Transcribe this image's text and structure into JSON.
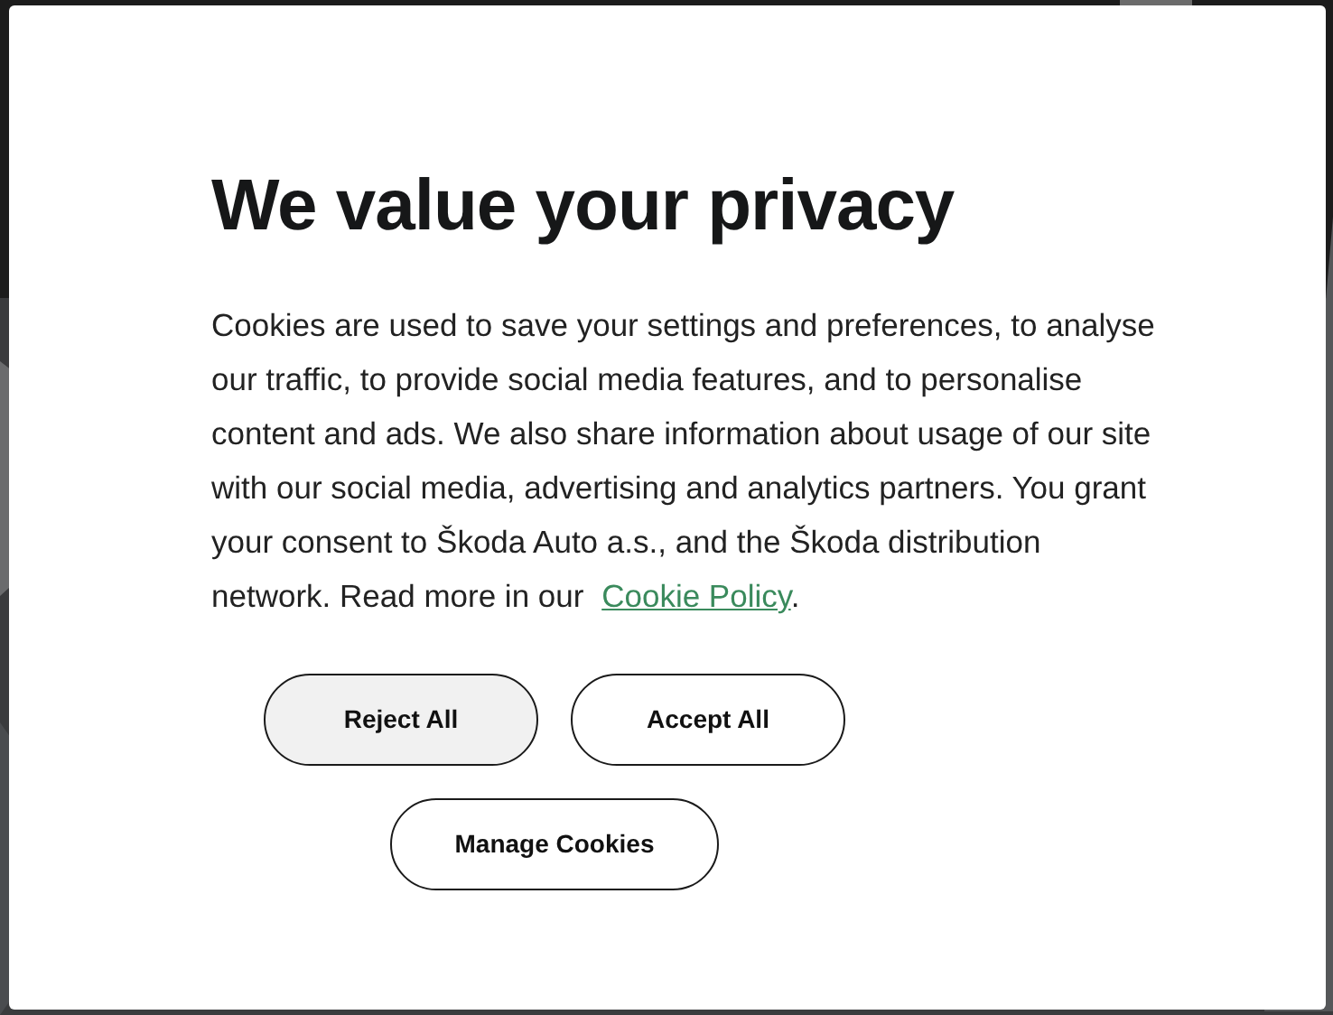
{
  "dialog": {
    "title": "We value your privacy",
    "body": "Cookies are used to save your settings and preferences, to analyse our traffic, to provide social media features, and to personalise content and ads. We also share information about usage of our site with our social media, advertising and analytics partners. You grant your consent to Škoda Auto a.s., and the Škoda distribution network. Read more in our",
    "link": "Cookie Policy",
    "after_link": ".",
    "buttons": [
      {
        "label": "Reject All",
        "hovered": true
      },
      {
        "label": "Accept All",
        "hovered": false
      },
      {
        "label": "Manage Cookies",
        "hovered": false
      }
    ]
  }
}
